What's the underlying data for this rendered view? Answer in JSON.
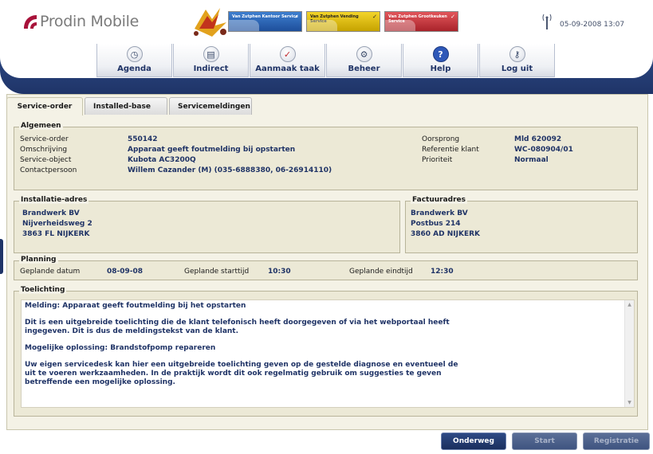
{
  "app": {
    "name": "Prodin Mobile",
    "datetime": "05-09-2008 13:07"
  },
  "banner": {
    "tiles": [
      {
        "label": "Van Zutphen Kantoor Service"
      },
      {
        "label": "Van Zutphen Vending Service"
      },
      {
        "label": "Van Zutphen Grootkeuken Service"
      }
    ]
  },
  "nav": {
    "items": [
      {
        "label": "Agenda",
        "icon": "clock-icon"
      },
      {
        "label": "Indirect",
        "icon": "document-icon"
      },
      {
        "label": "Aanmaak taak",
        "icon": "checklist-icon"
      },
      {
        "label": "Beheer",
        "icon": "gear-icon"
      },
      {
        "label": "Help",
        "icon": "question-icon"
      },
      {
        "label": "Log uit",
        "icon": "key-icon"
      }
    ]
  },
  "tabs": [
    {
      "label": "Service-order",
      "active": true
    },
    {
      "label": "Installed-base",
      "active": false
    },
    {
      "label": "Servicemeldingen",
      "active": false
    }
  ],
  "algemeen": {
    "title": "Algemeen",
    "left": [
      {
        "label": "Service-order",
        "value": "550142"
      },
      {
        "label": "Omschrijving",
        "value": "Apparaat geeft foutmelding bij opstarten"
      },
      {
        "label": "Service-object",
        "value": "Kubota AC3200Q"
      },
      {
        "label": "Contactpersoon",
        "value": "Willem Cazander (M) (035-6888380, 06-26914110)"
      }
    ],
    "right": [
      {
        "label": "Oorsprong",
        "value": "Mld 620092"
      },
      {
        "label": "Referentie klant",
        "value": "WC-080904/01"
      },
      {
        "label": "Prioriteit",
        "value": "Normaal"
      }
    ]
  },
  "installatie": {
    "title": "Installatie-adres",
    "lines": [
      "Brandwerk BV",
      "Nijverheidsweg 2",
      "3863 FL NIJKERK"
    ]
  },
  "factuur": {
    "title": "Factuuradres",
    "lines": [
      "Brandwerk BV",
      "Postbus 214",
      "3860 AD NIJKERK"
    ]
  },
  "planning": {
    "title": "Planning",
    "datum_label": "Geplande datum",
    "datum": "08-09-08",
    "start_label": "Geplande starttijd",
    "start": "10:30",
    "eind_label": "Geplande eindtijd",
    "eind": "12:30"
  },
  "toelichting": {
    "title": "Toelichting",
    "paragraphs": [
      "Melding: Apparaat geeft foutmelding bij het opstarten",
      "Dit is een uitgebreide toelichting die de klant telefonisch heeft doorgegeven of via het webportaal heeft ingegeven. Dit is dus de meldingstekst van de klant.",
      "Mogelijke oplossing: Brandstofpomp repareren",
      "Uw eigen servicedesk kan hier een uitgebreide toelichting geven op de gestelde diagnose en eventueel de uit te voeren werkzaamheden. In de praktijk wordt dit ook regelmatig gebruik om suggesties te geven betreffende een mogelijke oplossing."
    ]
  },
  "footer": {
    "onderweg": "Onderweg",
    "start": "Start",
    "registratie": "Registratie"
  },
  "colors": {
    "accent": "#1f3468",
    "value_text": "#1f3366",
    "panel_bg": "#f4f2e6"
  }
}
